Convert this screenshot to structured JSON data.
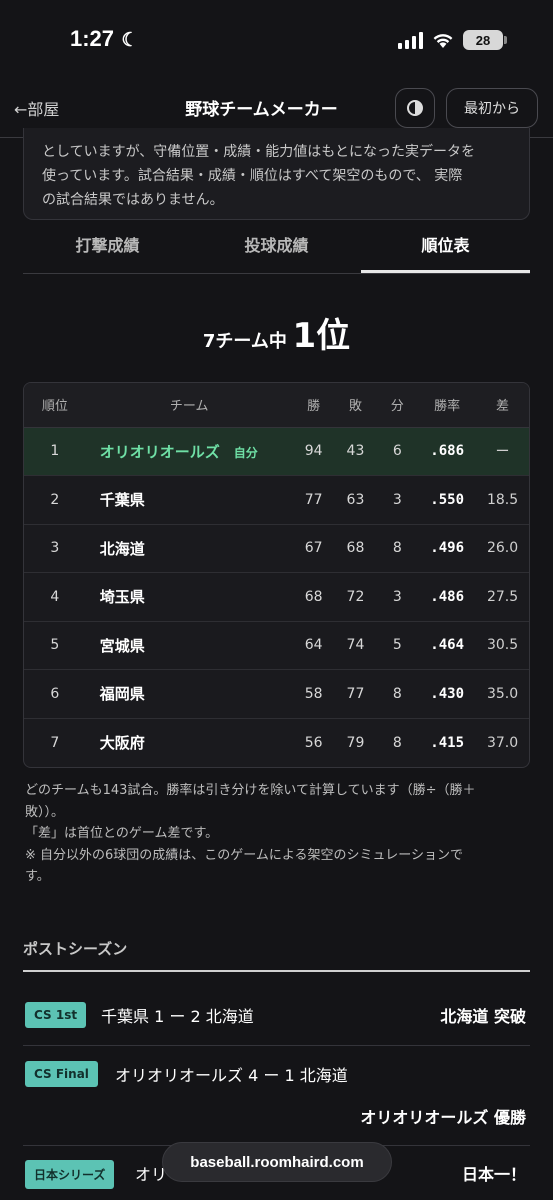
{
  "status_bar": {
    "time": "1:27",
    "battery": "28"
  },
  "header": {
    "back": "←部屋",
    "title": "野球チームメーカー",
    "restart": "最初から"
  },
  "notice": {
    "lines": [
      "としていますが、守備位置・成績・能力値はもとになった実データを",
      "使っています。試合結果・成績・順位はすべて架空のもので、 実際",
      "の試合結果ではありません。"
    ]
  },
  "tabs": [
    "打撃成績",
    "投球成績",
    "順位表"
  ],
  "active_tab": "順位表",
  "rank_summary": {
    "prefix": "7チーム中",
    "rank": "1位"
  },
  "standings": {
    "headers": {
      "rank": "順位",
      "team": "チーム",
      "wins": "勝",
      "losses": "敗",
      "draws": "分",
      "pct": "勝率",
      "gb": "差"
    },
    "mine_label": "自分",
    "rows": [
      {
        "rank": "1",
        "team": "オリオリオールズ",
        "wins": "94",
        "losses": "43",
        "draws": "6",
        "pct": ".686",
        "gb": "ー",
        "mine": true
      },
      {
        "rank": "2",
        "team": "千葉県",
        "wins": "77",
        "losses": "63",
        "draws": "3",
        "pct": ".550",
        "gb": "18.5"
      },
      {
        "rank": "3",
        "team": "北海道",
        "wins": "67",
        "losses": "68",
        "draws": "8",
        "pct": ".496",
        "gb": "26.0"
      },
      {
        "rank": "4",
        "team": "埼玉県",
        "wins": "68",
        "losses": "72",
        "draws": "3",
        "pct": ".486",
        "gb": "27.5"
      },
      {
        "rank": "5",
        "team": "宮城県",
        "wins": "64",
        "losses": "74",
        "draws": "5",
        "pct": ".464",
        "gb": "30.5"
      },
      {
        "rank": "6",
        "team": "福岡県",
        "wins": "58",
        "losses": "77",
        "draws": "8",
        "pct": ".430",
        "gb": "35.0"
      },
      {
        "rank": "7",
        "team": "大阪府",
        "wins": "56",
        "losses": "79",
        "draws": "8",
        "pct": ".415",
        "gb": "37.0"
      }
    ]
  },
  "notes": {
    "line1": "どのチームも143試合。勝率は引き分けを除いて計算しています（勝÷（勝＋",
    "line2": "敗））。",
    "line3": "「差」は首位とのゲーム差です。",
    "line4": "※ 自分以外の6球団の成績は、このゲームによる架空のシミュレーションで",
    "line5": "す。"
  },
  "postseason": {
    "title": "ポストシーズン",
    "series": [
      {
        "badge": "CS 1st",
        "score": "千葉県 1 ー 2 北海道",
        "result": "北海道 突破"
      },
      {
        "badge": "CS Final",
        "score": "オリオリオールズ 4 ー 1 北海道",
        "result": "オリオリオールズ 優勝"
      },
      {
        "badge": "日本シリーズ",
        "score": "オリ",
        "result": "日本一！"
      }
    ]
  },
  "url_bar": "baseball.roomhaird.com",
  "colors": {
    "accent": "#5cc3b4",
    "mine_text": "#6fe0a6",
    "mine_bg": "#1f3328",
    "background": "#141417"
  }
}
